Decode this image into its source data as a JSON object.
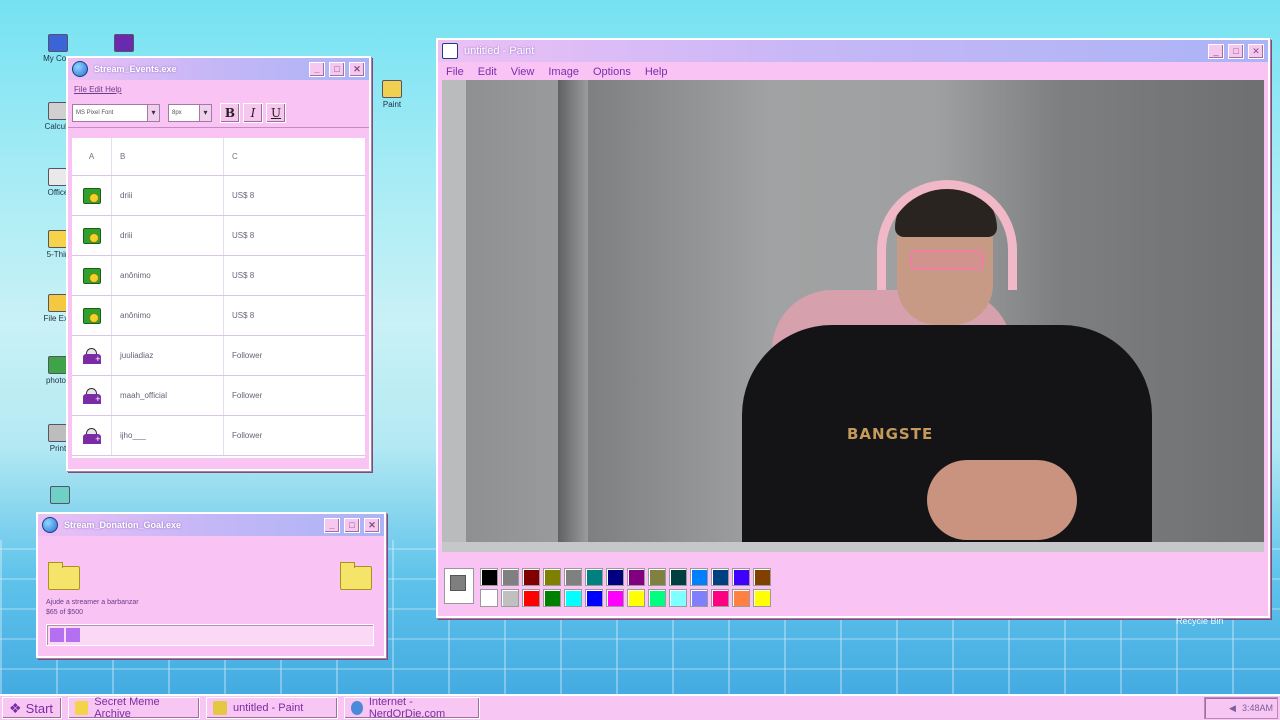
{
  "desktop_icons": [
    {
      "label": "My Com"
    },
    {
      "label": "Calcula"
    },
    {
      "label": "Office"
    },
    {
      "label": "5-Thin"
    },
    {
      "label": "File Exp"
    },
    {
      "label": "photos"
    },
    {
      "label": "Print"
    },
    {
      "label": "Paint"
    }
  ],
  "events_window": {
    "title": "Stream_Events.exe",
    "menu": "File Edit Help",
    "font_name": "MS Pixel Font",
    "font_size": "8px",
    "bold": "B",
    "italic": "I",
    "underline": "U",
    "columns": [
      "A",
      "B",
      "C"
    ],
    "rows": [
      {
        "icon": "cash-icon",
        "name": "driii",
        "value": "US$ 8"
      },
      {
        "icon": "cash-icon",
        "name": "driii",
        "value": "US$ 8"
      },
      {
        "icon": "cash-icon",
        "name": "anônimo",
        "value": "US$ 8"
      },
      {
        "icon": "cash-icon",
        "name": "anônimo",
        "value": "US$ 8"
      },
      {
        "icon": "follower-icon",
        "name": "juuliadiaz",
        "value": "Follower"
      },
      {
        "icon": "follower-icon",
        "name": "maah_official",
        "value": "Follower"
      },
      {
        "icon": "follower-icon",
        "name": "ijho___",
        "value": "Follower"
      }
    ]
  },
  "donation_window": {
    "title": "Stream_Donation_Goal.exe",
    "goal_text": "Ajude a streamer a barbanzar",
    "amount_text": "$65 of $500",
    "progress_fraction": 0.13
  },
  "paint_window": {
    "title": "untitled - Paint",
    "menu": [
      "File",
      "Edit",
      "View",
      "Image",
      "Options",
      "Help"
    ],
    "shirt_text": "BANGSTE",
    "palette_row1": [
      "#000000",
      "#808080",
      "#800000",
      "#808000",
      "#808080",
      "#008080",
      "#000080",
      "#800080",
      "#808040",
      "#004040",
      "#0080ff",
      "#004080",
      "#4000ff",
      "#804000"
    ],
    "palette_row2": [
      "#ffffff",
      "#c0c0c0",
      "#ff0000",
      "#008000",
      "#00ffff",
      "#0000ff",
      "#ff00ff",
      "#ffff00",
      "#00ff80",
      "#80ffff",
      "#8080ff",
      "#ff0080",
      "#ff8040",
      "#ffff00"
    ]
  },
  "recycle_bin": {
    "label": "Recycle Bin"
  },
  "taskbar": {
    "start": "Start",
    "items": [
      "Secret Meme Archive",
      "untitled - Paint",
      "Internet - NerdOrDie.com"
    ],
    "clock": "3:48AM"
  },
  "colors": {
    "accent": "#7a2ca6",
    "window_bg": "#f9c4f3"
  }
}
